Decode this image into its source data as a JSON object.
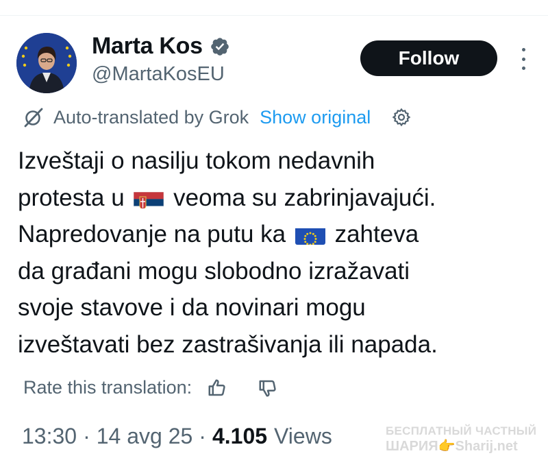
{
  "user": {
    "name": "Marta Kos",
    "handle": "@MartaKosEU",
    "verified": true
  },
  "actions": {
    "follow_label": "Follow",
    "more_icon": "more-icon"
  },
  "translation": {
    "icon": "grok-icon",
    "label": "Auto-translated by Grok",
    "show_original": "Show original",
    "settings_icon": "gear-icon"
  },
  "tweet": {
    "line1": "Izveštaji o nasilju tokom nedavnih",
    "line2_before": "protesta u",
    "line2_flag": "serbia-flag",
    "line2_after": "veoma su zabrinjavajući.",
    "line3_before": "Napredovanje na putu ka",
    "line3_flag": "eu-flag",
    "line3_after": "zahteva",
    "line4": "da građani mogu slobodno izražavati",
    "line5": "svoje stavove i da novinari mogu",
    "line6": "izveštavati bez zastrašivanja ili napada."
  },
  "rating": {
    "label": "Rate this translation:",
    "up_icon": "thumbs-up-icon",
    "down_icon": "thumbs-down-icon"
  },
  "meta": {
    "time": "13:30",
    "sep": "·",
    "date": "14 avg 25",
    "views_count": "4.105",
    "views_label": "Views"
  },
  "watermark": {
    "line1": "БЕСПЛАТНЫЙ ЧАСТНЫЙ",
    "line2": "ШАРИЯ👉Sharij.net"
  },
  "colors": {
    "text": "#0f1419",
    "secondary": "#536471",
    "link": "#1d9bf0",
    "verified": "#536471",
    "button": "#0f1419"
  }
}
